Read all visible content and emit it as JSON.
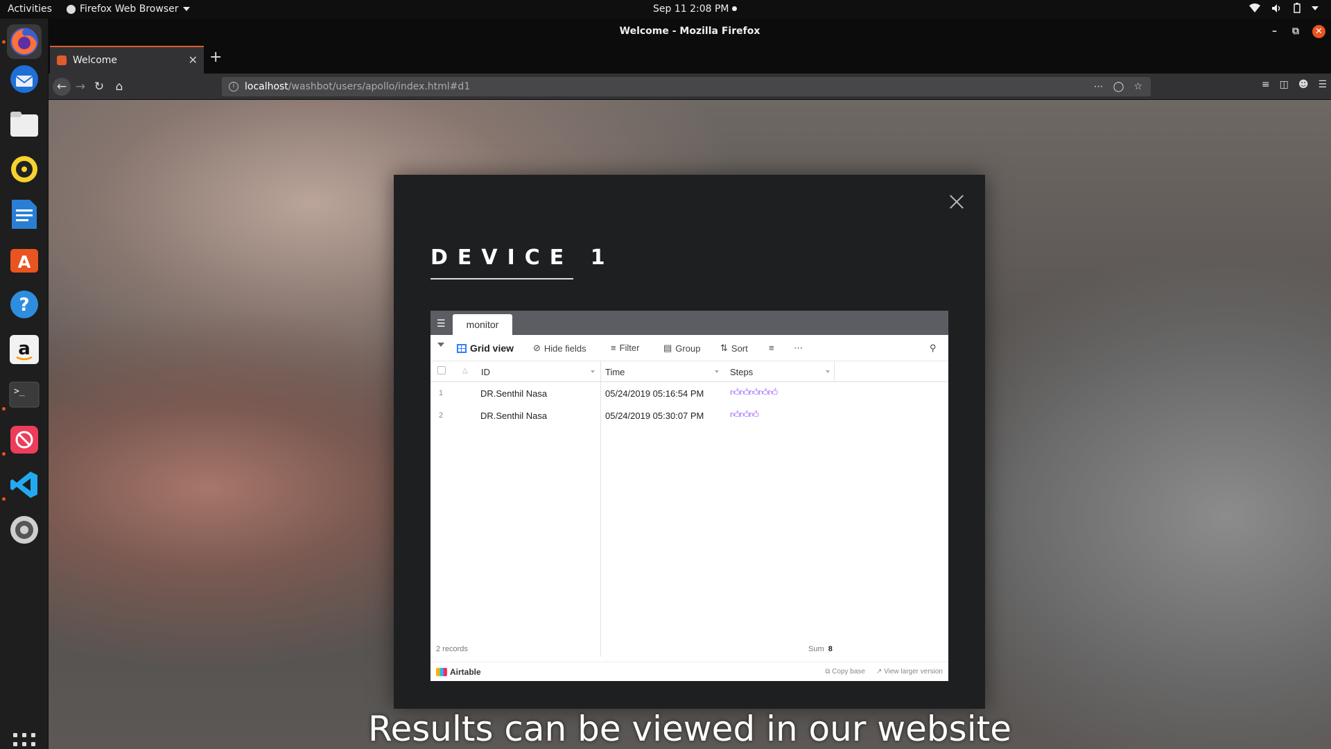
{
  "topbar": {
    "activities": "Activities",
    "app_menu": "Firefox Web Browser",
    "clock": "Sep 11  2:08 PM"
  },
  "dock": {
    "apps": [
      "firefox-icon",
      "thunderbird-icon",
      "files-icon",
      "rhythmbox-icon",
      "writer-icon",
      "software-center-icon",
      "help-icon",
      "amazon-icon",
      "terminal-icon",
      "blocked-app-icon",
      "vscode-icon",
      "settings-icon"
    ]
  },
  "window": {
    "title": "Welcome - Mozilla Firefox"
  },
  "tab": {
    "label": "Welcome"
  },
  "urlbar": {
    "host": "localhost",
    "path": "/washbot/users/apollo/index.html#d1"
  },
  "modal": {
    "title": "DEVICE 1"
  },
  "airtable": {
    "table_tab": "monitor",
    "toolbar": {
      "grid_view": "Grid view",
      "hide_fields": "Hide fields",
      "filter": "Filter",
      "group": "Group",
      "sort": "Sort"
    },
    "columns": [
      "ID",
      "Time",
      "Steps"
    ],
    "rows": [
      {
        "num": "1",
        "id": "DR.Senthil Nasa",
        "time": "05/24/2019 05:16:54 PM",
        "steps": 5
      },
      {
        "num": "2",
        "id": "DR.Senthil Nasa",
        "time": "05/24/2019 05:30:07 PM",
        "steps": 3
      }
    ],
    "footer": {
      "records": "2 records",
      "sum_label": "Sum",
      "sum_value": "8"
    },
    "brand": "Airtable",
    "links": {
      "copy_base": "Copy base",
      "view_larger": "View larger version"
    }
  },
  "caption": "Results can be viewed in our website",
  "colors": {
    "accent": "#e05c2c",
    "steps": "#8b46ff",
    "airtable_blue": "#2d7ff9"
  }
}
